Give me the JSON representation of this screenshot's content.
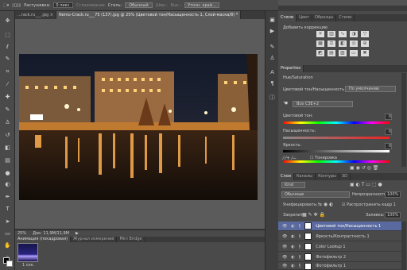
{
  "options": {
    "tool_icon": "marquee-icon",
    "feather_label": "Растушевка:",
    "feather_value": "0 пикс.",
    "antialias_label": "Сглаживание",
    "style_label": "Стиль:",
    "style_value": "Обычный",
    "width_label": "Шир.:",
    "height_label": "Выс.:",
    "refine_label": "Уточн. край..."
  },
  "documents": {
    "tabs": [
      {
        "label": "...rack.ru___.jpg ×"
      },
      {
        "label": "Nemo-Crack.ru___75 (137).jpg @ 25% (Цветовой тон/Насыщенность 1, Слой-маска/8) *"
      }
    ],
    "close_label": "×"
  },
  "status": {
    "zoom": "25%",
    "doc_size": "Док: 11,9M/11,9M",
    "arrow": "▶"
  },
  "minibridge": {
    "tabs": [
      "Анимация (покадровая)",
      "Журнал измерений",
      "Mini Bridge"
    ],
    "thumb_label": "1 сек."
  },
  "panels": {
    "top_tabs": [
      "Стили",
      "Цвет",
      "Образцы",
      "Стили"
    ],
    "adjust_label": "Добавить коррекцию"
  },
  "properties": {
    "tab": "Properties",
    "title": "Hue/Saturation",
    "preset_label": "Цветовой тон/Насыщенность",
    "preset_value": "По умолчанию",
    "channel_value": "Все СЗЕ+2",
    "hue_label": "Цветовой тон:",
    "hue_value": "0",
    "sat_label": "Насыщенность:",
    "sat_value": "0",
    "light_label": "Яркость:",
    "light_value": "0",
    "colorize_label": "Тонировка"
  },
  "layers": {
    "tabs": [
      "Слои",
      "Каналы",
      "Контуры",
      "3D"
    ],
    "kind_label": "Kind",
    "blend_value": "Обычные",
    "opacity_label": "Непрозрачность:",
    "opacity_value": "100%",
    "unify_label": "Унифицировать:",
    "propagate_label": "Распространить кадр 1",
    "lock_label": "Закрепить:",
    "fill_label": "Заливка:",
    "fill_value": "100%",
    "items": [
      {
        "name": "Цветовой тон/Насыщенность 1"
      },
      {
        "name": "Яркость/Контрастность 1"
      },
      {
        "name": "Color Lookup 1"
      },
      {
        "name": "Фотофильтр 2"
      },
      {
        "name": "Фотофильтр 1"
      }
    ]
  },
  "colors": {
    "accent": "#5a6aa0",
    "panel": "#4a4a4a",
    "workspace": "#5b5b5b"
  }
}
